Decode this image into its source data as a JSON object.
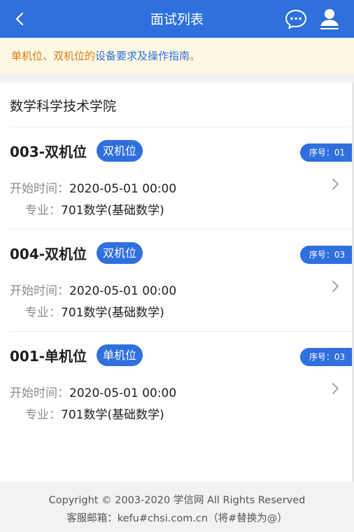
{
  "header": {
    "title": "面试列表",
    "back_icon": "chevron-left-icon",
    "chat_icon": "chat-bubble-icon",
    "user_icon": "user-icon"
  },
  "notice": {
    "prefix": "单机位、双机位的",
    "link": "设备要求及操作指南",
    "suffix": "。"
  },
  "school": "数学科学技术学院",
  "sessions": [
    {
      "name": "003-双机位",
      "badge": "双机位",
      "seq": "序号：01",
      "start_label": "开始时间：",
      "start": "2020-05-01 00:00",
      "major_label": "专业：",
      "major": "701数学(基础数学)"
    },
    {
      "name": "004-双机位",
      "badge": "双机位",
      "seq": "序号：03",
      "start_label": "开始时间：",
      "start": "2020-05-01 00:00",
      "major_label": "专业：",
      "major": "701数学(基础数学)"
    },
    {
      "name": "001-单机位",
      "badge": "单机位",
      "seq": "序号：03",
      "start_label": "开始时间：",
      "start": "2020-05-01 00:00",
      "major_label": "专业：",
      "major": "701数学(基础数学)"
    }
  ],
  "footer": {
    "copyright": "Copyright © 2003-2020 学信网 All Rights Reserved",
    "service": "客服邮箱：kefu#chsi.com.cn（将#替换为@）"
  },
  "colors": {
    "primary": "#2f6fde",
    "notice_text": "#e07a16",
    "notice_bg": "#fdf9e4"
  }
}
